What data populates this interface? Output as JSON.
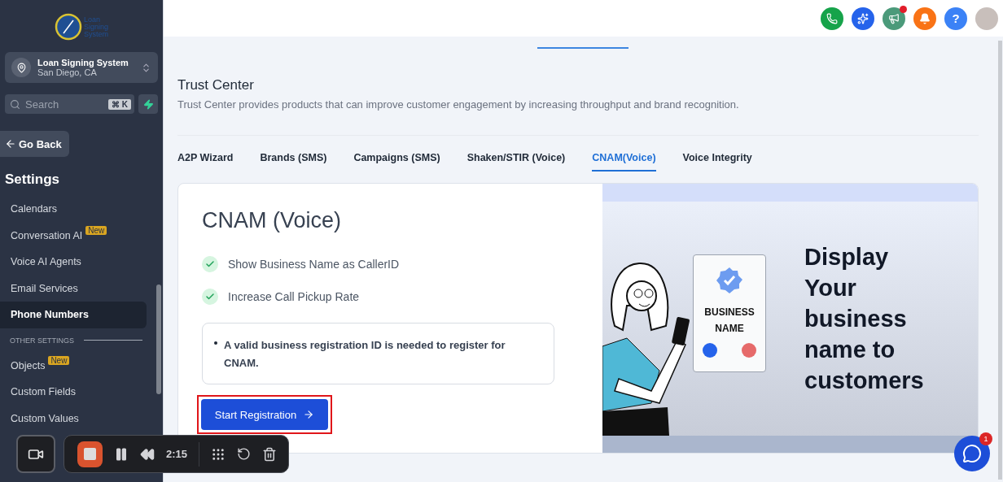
{
  "sidebar": {
    "logo_lines": [
      "Loan",
      "Signing",
      "System"
    ],
    "location": {
      "name": "Loan Signing System",
      "address": "San Diego, CA"
    },
    "search": {
      "placeholder": "Search",
      "shortcut": "⌘ K"
    },
    "back_button": "Go Back",
    "title": "Settings",
    "items": [
      {
        "kind": "item",
        "label": "Calendars",
        "selected": false
      },
      {
        "kind": "item",
        "label": "Conversation AI",
        "badge": "New",
        "selected": false
      },
      {
        "kind": "item",
        "label": "Voice AI Agents",
        "selected": false
      },
      {
        "kind": "item",
        "label": "Email Services",
        "selected": false
      },
      {
        "kind": "item",
        "label": "Phone Numbers",
        "selected": true
      },
      {
        "kind": "section",
        "label": "OTHER SETTINGS"
      },
      {
        "kind": "item",
        "label": "Objects",
        "badge": "New",
        "selected": false
      },
      {
        "kind": "item",
        "label": "Custom Fields",
        "selected": false
      },
      {
        "kind": "item",
        "label": "Custom Values",
        "selected": false
      }
    ]
  },
  "header": {
    "help_label": "?",
    "notification_dot": true
  },
  "page": {
    "title": "Trust Center",
    "description": "Trust Center provides products that can improve customer engagement by increasing throughput and brand recognition.",
    "tabs": [
      {
        "label": "A2P Wizard",
        "selected": false
      },
      {
        "label": "Brands (SMS)",
        "selected": false
      },
      {
        "label": "Campaigns (SMS)",
        "selected": false
      },
      {
        "label": "Shaken/STIR (Voice)",
        "selected": false
      },
      {
        "label": "CNAM(Voice)",
        "selected": true
      },
      {
        "label": "Voice Integrity",
        "selected": false
      }
    ]
  },
  "card": {
    "title": "CNAM (Voice)",
    "features": [
      "Show Business Name as CallerID",
      "Increase Call Pickup Rate"
    ],
    "note": "A valid business registration ID is needed to register for CNAM.",
    "button": "Start Registration",
    "button_highlighted": true,
    "promo_heading": "Display Your business name to customers",
    "phone_card_text": "BUSINESS NAME"
  },
  "recorder": {
    "time": "2:15"
  },
  "chat": {
    "badge": "1"
  }
}
